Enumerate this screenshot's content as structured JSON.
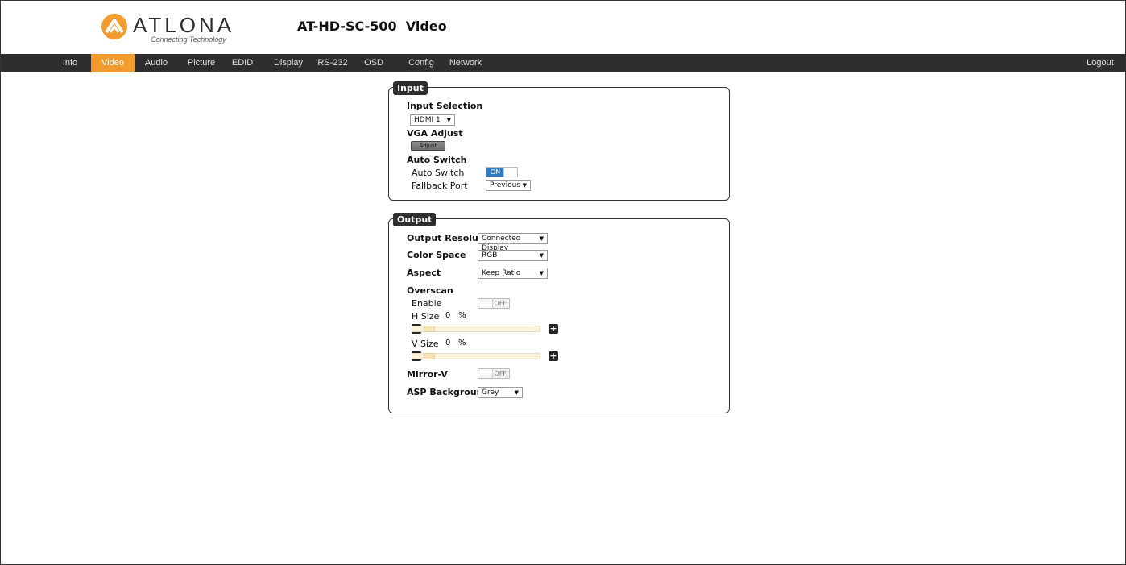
{
  "header": {
    "logo_text": "ATLONA",
    "logo_tagline": "Connecting Technology",
    "page_title": "AT-HD-SC-500  Video",
    "brand_color": "#f29b2f"
  },
  "nav": {
    "items": [
      "Info",
      "Video",
      "Audio",
      "Picture",
      "EDID",
      "Display",
      "RS-232",
      "OSD",
      "Config",
      "Network"
    ],
    "active": "Video",
    "logout": "Logout"
  },
  "input": {
    "legend": "Input",
    "input_selection_label": "Input Selection",
    "input_selection_value": "HDMI 1",
    "vga_adjust_label": "VGA Adjust",
    "adjust_button": "Adjust",
    "auto_switch_heading": "Auto Switch",
    "auto_switch_label": "Auto Switch",
    "auto_switch_state": "ON",
    "fallback_port_label": "Fallback Port",
    "fallback_port_value": "Previous"
  },
  "output": {
    "legend": "Output",
    "output_resolution_label": "Output Resolution",
    "output_resolution_value": "Connected Display",
    "color_space_label": "Color Space",
    "color_space_value": "RGB",
    "aspect_label": "Aspect",
    "aspect_value": "Keep Ratio",
    "overscan_label": "Overscan",
    "enable_label": "Enable",
    "enable_state": "OFF",
    "h_size_label": "H Size",
    "h_size_value": "0",
    "h_size_unit": "%",
    "v_size_label": "V Size",
    "v_size_value": "0",
    "v_size_unit": "%",
    "mirror_v_label": "Mirror-V",
    "mirror_v_state": "OFF",
    "asp_background_label": "ASP Background",
    "asp_background_value": "Grey"
  }
}
